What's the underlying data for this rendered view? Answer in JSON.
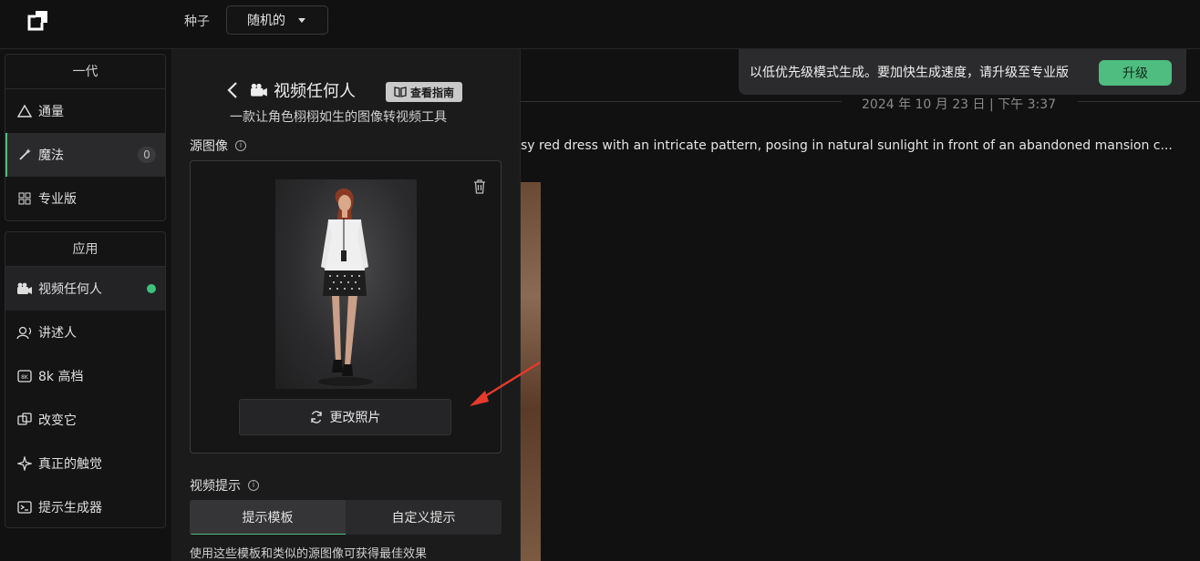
{
  "topbar": {
    "seed_label": "种子",
    "seed_value": "随机的"
  },
  "nav": {
    "group1": {
      "title": "一代",
      "items": [
        {
          "label": "通量",
          "icon": "triangle-icon"
        },
        {
          "label": "魔法",
          "icon": "magic-wand-icon",
          "badge": "0"
        },
        {
          "label": "专业版",
          "icon": "grid-icon"
        }
      ]
    },
    "group2": {
      "title": "应用",
      "items": [
        {
          "label": "视频任何人",
          "icon": "camera-icon"
        },
        {
          "label": "讲述人",
          "icon": "voice-icon"
        },
        {
          "label": "8k 高档",
          "icon": "8k-icon"
        },
        {
          "label": "改变它",
          "icon": "swap-icon"
        },
        {
          "label": "真正的触觉",
          "icon": "sparkle-icon"
        },
        {
          "label": "提示生成器",
          "icon": "terminal-icon"
        }
      ]
    }
  },
  "panel": {
    "title": "视频任何人",
    "guide_label": "查看指南",
    "subtitle": "一款让角色栩栩如生的图像转视频工具",
    "source_label": "源图像",
    "change_photo": "更改照片",
    "video_prompt_label": "视频提示",
    "tabs": [
      "提示模板",
      "自定义提示"
    ],
    "hint": "使用这些模板和类似的源图像可获得最佳效果"
  },
  "main": {
    "timestamp": "2024 年 10 月 23 日 | 下午 3:37",
    "prompt": "sy red dress with an intricate pattern, posing in natural sunlight in front of an abandoned mansion c..."
  },
  "toast": {
    "text": "以低优先级模式生成。要加快生成速度，请升级至专业版",
    "button": "升级"
  },
  "colors": {
    "accent": "#4fbd7f",
    "background": "#111112",
    "panel": "#1b1b1c"
  }
}
